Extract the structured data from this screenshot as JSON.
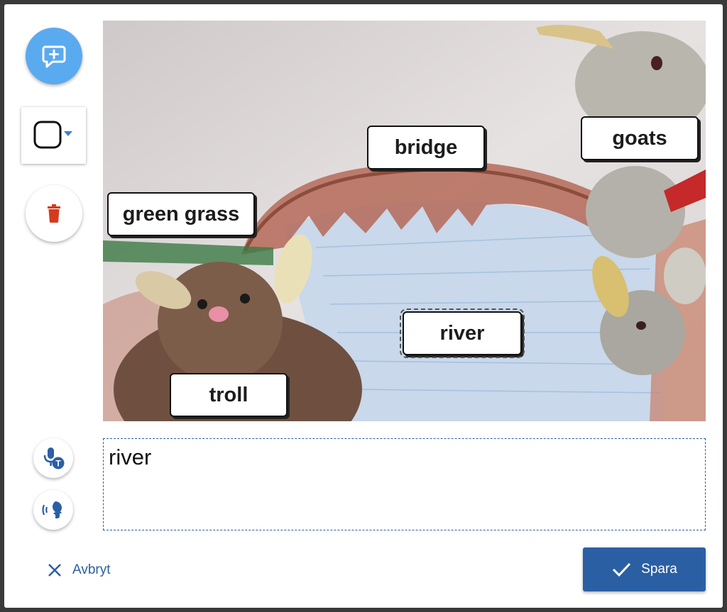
{
  "labels": [
    {
      "id": "green-grass",
      "text": "green grass",
      "selected": false
    },
    {
      "id": "bridge",
      "text": "bridge",
      "selected": false
    },
    {
      "id": "goats",
      "text": "goats",
      "selected": false
    },
    {
      "id": "river",
      "text": "river",
      "selected": true
    },
    {
      "id": "troll",
      "text": "troll",
      "selected": false
    }
  ],
  "editor": {
    "text": "river"
  },
  "actions": {
    "cancel_label": "Avbryt",
    "save_label": "Spara"
  },
  "icons": {
    "add": "add-comment-icon",
    "shape": "square-outline-icon",
    "delete": "trash-icon",
    "stt": "speech-to-text-icon",
    "tts": "text-to-speech-icon",
    "cancel": "close-icon",
    "save": "check-icon"
  },
  "colors": {
    "accent": "#2b5fa4",
    "fab": "#5aaaf0",
    "delete": "#d63a1e"
  }
}
